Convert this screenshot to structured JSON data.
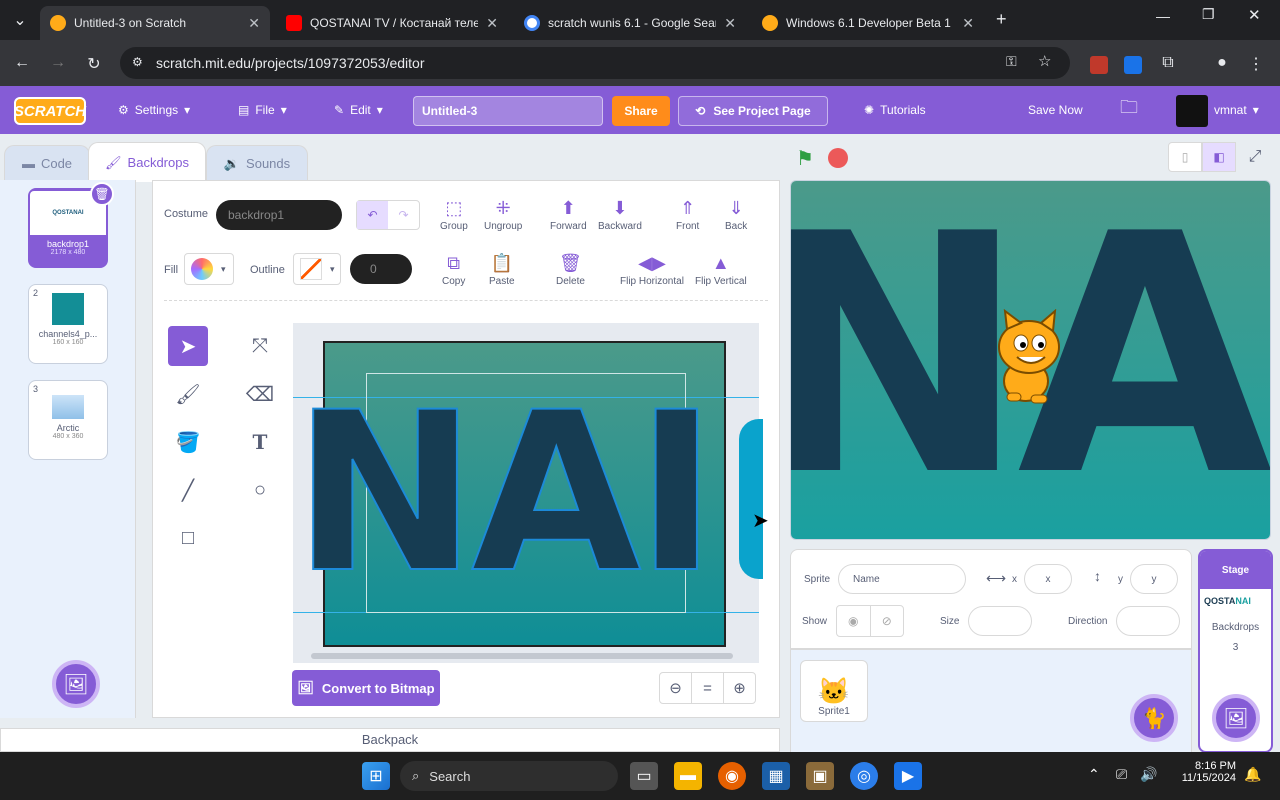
{
  "browser": {
    "tabs": [
      {
        "title": "Untitled-3 on Scratch",
        "active": true
      },
      {
        "title": "QOSTANAI TV / Костанай теле"
      },
      {
        "title": "scratch wunis 6.1 - Google Sear"
      },
      {
        "title": "Windows 6.1 Developer Beta 1"
      }
    ],
    "url": "scratch.mit.edu/projects/1097372053/editor",
    "new_tab": "+"
  },
  "menu": {
    "logo": "SCRATCH",
    "settings": "Settings",
    "file": "File",
    "edit": "Edit",
    "project_title": "Untitled-3",
    "share": "Share",
    "see_project": "See Project Page",
    "tutorials": "Tutorials",
    "save_now": "Save Now",
    "username": "vmnat"
  },
  "editor_tabs": {
    "code": "Code",
    "backdrops": "Backdrops",
    "sounds": "Sounds"
  },
  "backdrops": [
    {
      "num": "1",
      "name": "backdrop1",
      "size": "2178 x 480",
      "selected": true
    },
    {
      "num": "2",
      "name": "channels4_p...",
      "size": "160 x 160"
    },
    {
      "num": "3",
      "name": "Arctic",
      "size": "480 x 360"
    }
  ],
  "paint": {
    "costume_label": "Costume",
    "costume_name": "backdrop1",
    "fill_label": "Fill",
    "outline_label": "Outline",
    "outline_width": "0",
    "actions_row1": [
      "Group",
      "Ungroup",
      "Forward",
      "Backward",
      "Front",
      "Back"
    ],
    "actions_row2": [
      "Copy",
      "Paste",
      "Delete",
      "Flip Horizontal",
      "Flip Vertical"
    ],
    "convert": "Convert to Bitmap",
    "canvas_text": "NAI"
  },
  "backpack": "Backpack",
  "stage_text": "NAI",
  "sprite_info": {
    "sprite_label": "Sprite",
    "name_placeholder": "Name",
    "x_label": "x",
    "x_placeholder": "x",
    "y_label": "y",
    "y_placeholder": "y",
    "show_label": "Show",
    "size_label": "Size",
    "direction_label": "Direction"
  },
  "sprites": [
    {
      "name": "Sprite1"
    }
  ],
  "stage_pane": {
    "title": "Stage",
    "thumb_text_1": "QOSTA",
    "thumb_text_2": "NAI",
    "backdrops_label": "Backdrops",
    "backdrops_count": "3"
  },
  "taskbar": {
    "search": "Search",
    "time": "8:16 PM",
    "date": "11/15/2024"
  },
  "colors": {
    "scratch_purple": "#855cd6",
    "share_orange": "#ff8c1a",
    "stage_teal": "#2a8f8f"
  }
}
